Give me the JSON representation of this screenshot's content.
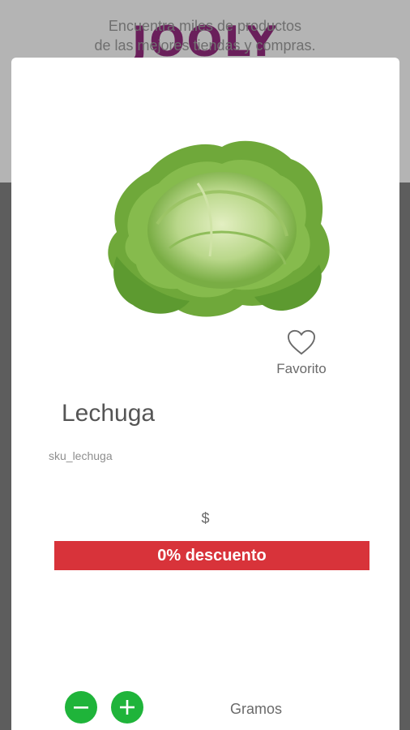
{
  "background": {
    "tagline": "Encuentra miles de productos\nde las mejores tiendas y compras.",
    "logo": "JOOLY"
  },
  "product": {
    "image_icon": "lettuce-image",
    "name": "Lechuga",
    "sku": "sku_lechuga",
    "price": "$",
    "discount_label": "0% descuento"
  },
  "favorite": {
    "icon": "heart-icon",
    "label": "Favorito"
  },
  "quantity": {
    "minus_icon": "minus-icon",
    "plus_icon": "plus-icon",
    "unit_label": "Gramos"
  },
  "colors": {
    "accent_green": "#1fb43a",
    "discount_red": "#d8333a",
    "logo_purple": "#6a1f5b"
  }
}
